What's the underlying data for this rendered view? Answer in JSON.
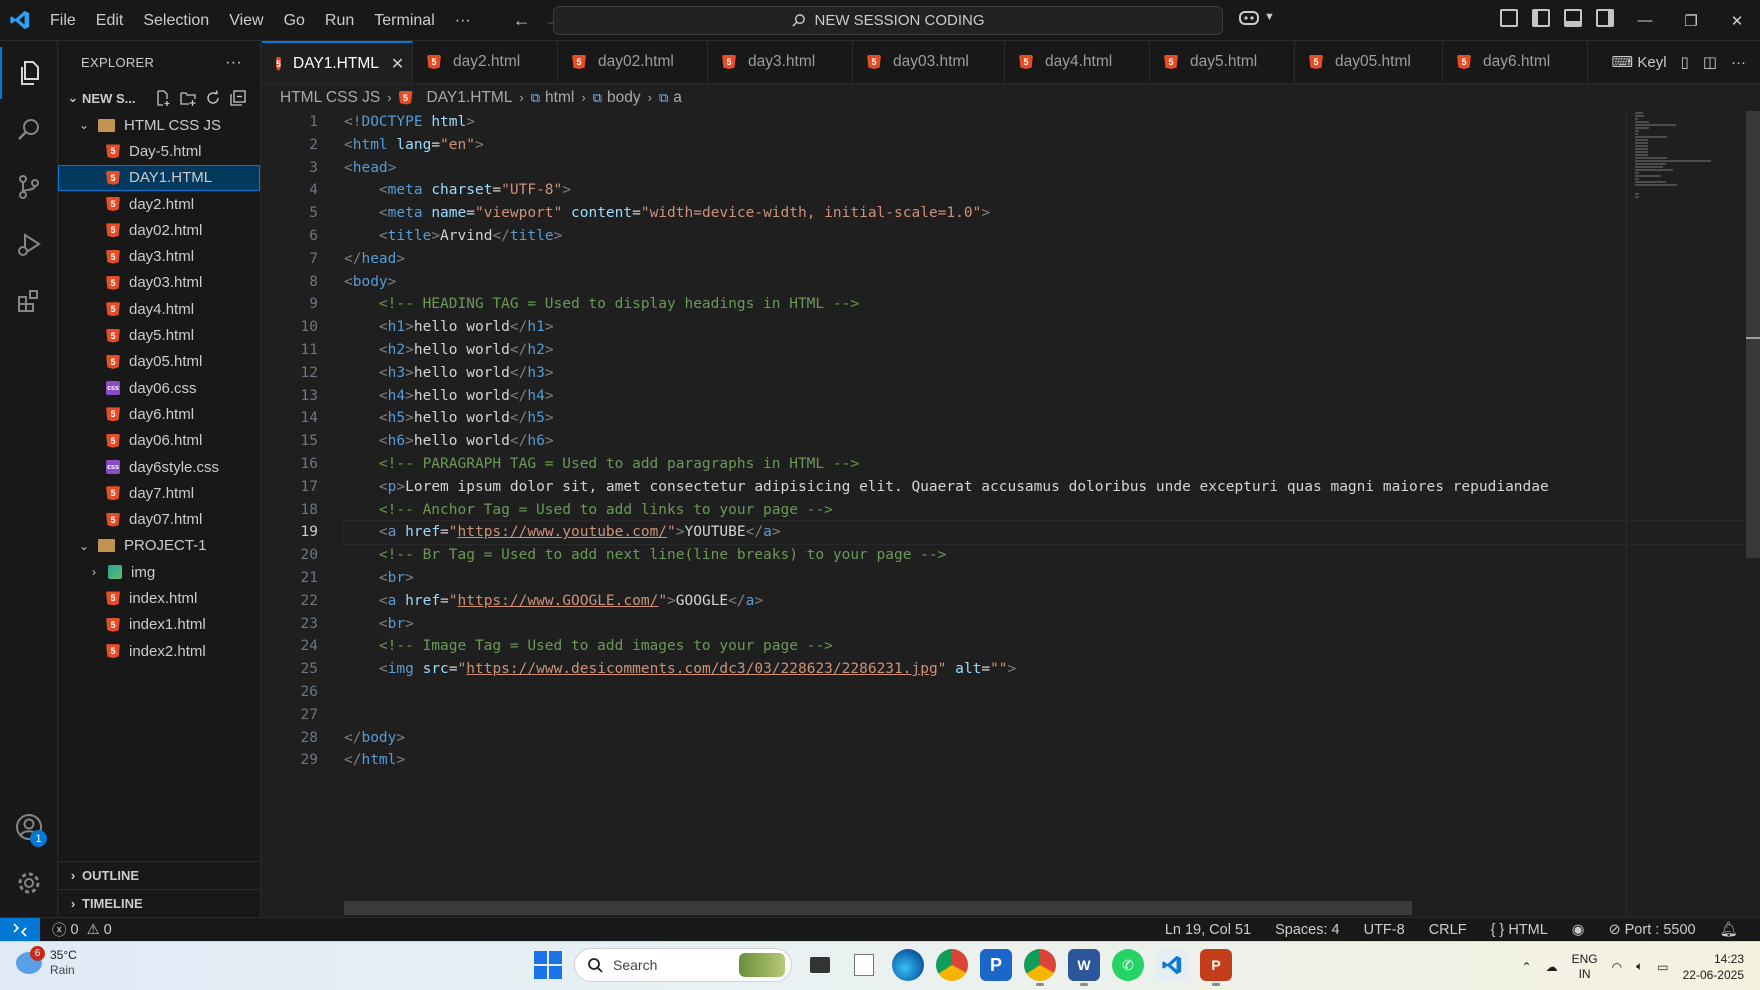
{
  "titlebar": {
    "menu": [
      "File",
      "Edit",
      "Selection",
      "View",
      "Go",
      "Run",
      "Terminal",
      "···"
    ],
    "command_center": "NEW SESSION CODING"
  },
  "sidebar": {
    "title": "EXPLORER",
    "root_label": "NEW S...",
    "tree": [
      {
        "label": "HTML CSS JS",
        "type": "folder",
        "level": 1,
        "expanded": true
      },
      {
        "label": "Day-5.html",
        "type": "html",
        "level": 2
      },
      {
        "label": "DAY1.HTML",
        "type": "html",
        "level": 2,
        "selected": true
      },
      {
        "label": "day2.html",
        "type": "html",
        "level": 2
      },
      {
        "label": "day02.html",
        "type": "html",
        "level": 2
      },
      {
        "label": "day3.html",
        "type": "html",
        "level": 2
      },
      {
        "label": "day03.html",
        "type": "html",
        "level": 2
      },
      {
        "label": "day4.html",
        "type": "html",
        "level": 2
      },
      {
        "label": "day5.html",
        "type": "html",
        "level": 2
      },
      {
        "label": "day05.html",
        "type": "html",
        "level": 2
      },
      {
        "label": "day06.css",
        "type": "css",
        "level": 2
      },
      {
        "label": "day6.html",
        "type": "html",
        "level": 2
      },
      {
        "label": "day06.html",
        "type": "html",
        "level": 2
      },
      {
        "label": "day6style.css",
        "type": "css",
        "level": 2
      },
      {
        "label": "day7.html",
        "type": "html",
        "level": 2
      },
      {
        "label": "day07.html",
        "type": "html",
        "level": 2
      },
      {
        "label": "PROJECT-1",
        "type": "folder",
        "level": 1,
        "expanded": true
      },
      {
        "label": "img",
        "type": "img",
        "level": 2,
        "collapsed": true
      },
      {
        "label": "index.html",
        "type": "html",
        "level": 2
      },
      {
        "label": "index1.html",
        "type": "html",
        "level": 2
      },
      {
        "label": "index2.html",
        "type": "html",
        "level": 2
      }
    ],
    "outline_label": "OUTLINE",
    "timeline_label": "TIMELINE"
  },
  "tabs": [
    {
      "label": "DAY1.HTML",
      "active": true
    },
    {
      "label": "day2.html"
    },
    {
      "label": "day02.html"
    },
    {
      "label": "day3.html"
    },
    {
      "label": "day03.html"
    },
    {
      "label": "day4.html"
    },
    {
      "label": "day5.html"
    },
    {
      "label": "day05.html"
    },
    {
      "label": "day6.html"
    }
  ],
  "tab_overflow_label": "Keyl",
  "breadcrumb": [
    "HTML CSS JS",
    "DAY1.HTML",
    "html",
    "body",
    "a"
  ],
  "editor": {
    "current_line": 19,
    "lines": [
      [
        [
          "br",
          "<!"
        ],
        [
          "tag",
          "DOCTYPE"
        ],
        [
          "txt",
          " "
        ],
        [
          "attr",
          "html"
        ],
        [
          "br",
          ">"
        ]
      ],
      [
        [
          "br",
          "<"
        ],
        [
          "tag",
          "html"
        ],
        [
          "txt",
          " "
        ],
        [
          "attr",
          "lang"
        ],
        [
          "txt",
          "="
        ],
        [
          "str",
          "\"en\""
        ],
        [
          "br",
          ">"
        ]
      ],
      [
        [
          "br",
          "<"
        ],
        [
          "tag",
          "head"
        ],
        [
          "br",
          ">"
        ]
      ],
      [
        [
          "txt",
          "    "
        ],
        [
          "br",
          "<"
        ],
        [
          "tag",
          "meta"
        ],
        [
          "txt",
          " "
        ],
        [
          "attr",
          "charset"
        ],
        [
          "txt",
          "="
        ],
        [
          "str",
          "\"UTF-8\""
        ],
        [
          "br",
          ">"
        ]
      ],
      [
        [
          "txt",
          "    "
        ],
        [
          "br",
          "<"
        ],
        [
          "tag",
          "meta"
        ],
        [
          "txt",
          " "
        ],
        [
          "attr",
          "name"
        ],
        [
          "txt",
          "="
        ],
        [
          "str",
          "\"viewport\""
        ],
        [
          "txt",
          " "
        ],
        [
          "attr",
          "content"
        ],
        [
          "txt",
          "="
        ],
        [
          "str",
          "\"width=device-width, initial-scale=1.0\""
        ],
        [
          "br",
          ">"
        ]
      ],
      [
        [
          "txt",
          "    "
        ],
        [
          "br",
          "<"
        ],
        [
          "tag",
          "title"
        ],
        [
          "br",
          ">"
        ],
        [
          "txt",
          "Arvind"
        ],
        [
          "br",
          "</"
        ],
        [
          "tag",
          "title"
        ],
        [
          "br",
          ">"
        ]
      ],
      [
        [
          "br",
          "</"
        ],
        [
          "tag",
          "head"
        ],
        [
          "br",
          ">"
        ]
      ],
      [
        [
          "br",
          "<"
        ],
        [
          "tag",
          "body"
        ],
        [
          "br",
          ">"
        ]
      ],
      [
        [
          "txt",
          "    "
        ],
        [
          "com",
          "<!-- HEADING TAG = Used to display headings in HTML -->"
        ]
      ],
      [
        [
          "txt",
          "    "
        ],
        [
          "br",
          "<"
        ],
        [
          "tag",
          "h1"
        ],
        [
          "br",
          ">"
        ],
        [
          "txt",
          "hello world"
        ],
        [
          "br",
          "</"
        ],
        [
          "tag",
          "h1"
        ],
        [
          "br",
          ">"
        ]
      ],
      [
        [
          "txt",
          "    "
        ],
        [
          "br",
          "<"
        ],
        [
          "tag",
          "h2"
        ],
        [
          "br",
          ">"
        ],
        [
          "txt",
          "hello world"
        ],
        [
          "br",
          "</"
        ],
        [
          "tag",
          "h2"
        ],
        [
          "br",
          ">"
        ]
      ],
      [
        [
          "txt",
          "    "
        ],
        [
          "br",
          "<"
        ],
        [
          "tag",
          "h3"
        ],
        [
          "br",
          ">"
        ],
        [
          "txt",
          "hello world"
        ],
        [
          "br",
          "</"
        ],
        [
          "tag",
          "h3"
        ],
        [
          "br",
          ">"
        ]
      ],
      [
        [
          "txt",
          "    "
        ],
        [
          "br",
          "<"
        ],
        [
          "tag",
          "h4"
        ],
        [
          "br",
          ">"
        ],
        [
          "txt",
          "hello world"
        ],
        [
          "br",
          "</"
        ],
        [
          "tag",
          "h4"
        ],
        [
          "br",
          ">"
        ]
      ],
      [
        [
          "txt",
          "    "
        ],
        [
          "br",
          "<"
        ],
        [
          "tag",
          "h5"
        ],
        [
          "br",
          ">"
        ],
        [
          "txt",
          "hello world"
        ],
        [
          "br",
          "</"
        ],
        [
          "tag",
          "h5"
        ],
        [
          "br",
          ">"
        ]
      ],
      [
        [
          "txt",
          "    "
        ],
        [
          "br",
          "<"
        ],
        [
          "tag",
          "h6"
        ],
        [
          "br",
          ">"
        ],
        [
          "txt",
          "hello world"
        ],
        [
          "br",
          "</"
        ],
        [
          "tag",
          "h6"
        ],
        [
          "br",
          ">"
        ]
      ],
      [
        [
          "txt",
          "    "
        ],
        [
          "com",
          "<!-- PARAGRAPH TAG = Used to add paragraphs in HTML -->"
        ]
      ],
      [
        [
          "txt",
          "    "
        ],
        [
          "br",
          "<"
        ],
        [
          "tag",
          "p"
        ],
        [
          "br",
          ">"
        ],
        [
          "txt",
          "Lorem ipsum dolor sit, amet consectetur adipisicing elit. Quaerat accusamus doloribus unde excepturi quas magni maiores repudiandae"
        ]
      ],
      [
        [
          "txt",
          "    "
        ],
        [
          "com",
          "<!-- Anchor Tag = Used to add links to your page -->"
        ]
      ],
      [
        [
          "txt",
          "    "
        ],
        [
          "br",
          "<"
        ],
        [
          "tag",
          "a"
        ],
        [
          "txt",
          " "
        ],
        [
          "attr",
          "href"
        ],
        [
          "txt",
          "="
        ],
        [
          "str",
          "\""
        ],
        [
          "url",
          "https://www.youtube.com/"
        ],
        [
          "str",
          "\""
        ],
        [
          "br",
          ">"
        ],
        [
          "txt",
          "YOUTUBE"
        ],
        [
          "br",
          "</"
        ],
        [
          "tag",
          "a"
        ],
        [
          "br",
          ">"
        ]
      ],
      [
        [
          "txt",
          "    "
        ],
        [
          "com",
          "<!-- Br Tag = Used to add next line(line breaks) to your page -->"
        ]
      ],
      [
        [
          "txt",
          "    "
        ],
        [
          "br",
          "<"
        ],
        [
          "tag",
          "br"
        ],
        [
          "br",
          ">"
        ]
      ],
      [
        [
          "txt",
          "    "
        ],
        [
          "br",
          "<"
        ],
        [
          "tag",
          "a"
        ],
        [
          "txt",
          " "
        ],
        [
          "attr",
          "href"
        ],
        [
          "txt",
          "="
        ],
        [
          "str",
          "\""
        ],
        [
          "url",
          "https://www.GOOGLE.com/"
        ],
        [
          "str",
          "\""
        ],
        [
          "br",
          ">"
        ],
        [
          "txt",
          "GOOGLE"
        ],
        [
          "br",
          "</"
        ],
        [
          "tag",
          "a"
        ],
        [
          "br",
          ">"
        ]
      ],
      [
        [
          "txt",
          "    "
        ],
        [
          "br",
          "<"
        ],
        [
          "tag",
          "br"
        ],
        [
          "br",
          ">"
        ]
      ],
      [
        [
          "txt",
          "    "
        ],
        [
          "com",
          "<!-- Image Tag = Used to add images to your page -->"
        ]
      ],
      [
        [
          "txt",
          "    "
        ],
        [
          "br",
          "<"
        ],
        [
          "tag",
          "img"
        ],
        [
          "txt",
          " "
        ],
        [
          "attr",
          "src"
        ],
        [
          "txt",
          "="
        ],
        [
          "str",
          "\""
        ],
        [
          "url",
          "https://www.desicomments.com/dc3/03/228623/2286231.jpg"
        ],
        [
          "str",
          "\""
        ],
        [
          "txt",
          " "
        ],
        [
          "attr",
          "alt"
        ],
        [
          "txt",
          "="
        ],
        [
          "str",
          "\"\""
        ],
        [
          "br",
          ">"
        ]
      ],
      [
        [
          "txt",
          ""
        ]
      ],
      [
        [
          "txt",
          ""
        ]
      ],
      [
        [
          "br",
          "</"
        ],
        [
          "tag",
          "body"
        ],
        [
          "br",
          ">"
        ]
      ],
      [
        [
          "br",
          "</"
        ],
        [
          "tag",
          "html"
        ],
        [
          "br",
          ">"
        ]
      ]
    ]
  },
  "statusbar": {
    "errors": "0",
    "warnings": "0",
    "position": "Ln 19, Col 51",
    "spaces": "Spaces: 4",
    "encoding": "UTF-8",
    "eol": "CRLF",
    "language": "HTML",
    "port": "Port : 5500"
  },
  "taskbar": {
    "weather_temp": "35°C",
    "weather_cond": "Rain",
    "weather_badge": "6",
    "search_label": "Search",
    "lang_1": "ENG",
    "lang_2": "IN",
    "time": "14:23",
    "date": "22-06-2025"
  },
  "accounts_badge": "1",
  "colors": {
    "accent": "#0078d4",
    "html_icon": "#e44d26",
    "css_icon": "#8a4ec4"
  }
}
